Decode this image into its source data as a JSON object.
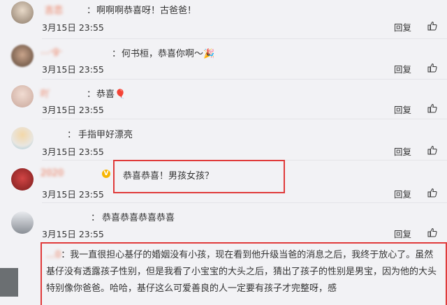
{
  "comments": [
    {
      "name": "吉恋",
      "text": "啊啊啊恭喜呀！古爸爸！",
      "time": "3月15日 23:55",
      "reply": "回复"
    },
    {
      "name": "…-g-",
      "text": "何书桓，恭喜你啊～🎉",
      "time": "3月15日 23:55",
      "reply": "回复"
    },
    {
      "name": "吖",
      "text": "恭喜🎈",
      "time": "3月15日 23:55",
      "reply": "回复"
    },
    {
      "name": "",
      "text": "手指甲好漂亮",
      "time": "3月15日 23:55",
      "reply": "回复"
    },
    {
      "name": "2020",
      "text": "恭喜恭喜！男孩女孩？",
      "time": "3月15日 23:55",
      "reply": "回复"
    },
    {
      "name": "",
      "text": "恭喜恭喜恭喜恭喜",
      "time": "3月15日 23:55",
      "reply": "回复"
    }
  ],
  "last_comment": {
    "name": "…0",
    "text": "我一直很担心基仔的婚姻没有小孩，现在看到他升级当爸的消息之后，我终于放心了。虽然基仔没有透露孩子性别，但是我看了小宝宝的大头之后，猜出了孩子的性别是男宝，因为他的大头特别像你爸爸。哈哈，基仔这么可爱善良的人一定要有孩子才完整呀，感"
  },
  "colors": {
    "highlight": "#e03a3a",
    "username": "#eb7350",
    "background": "#f2f2f5"
  }
}
